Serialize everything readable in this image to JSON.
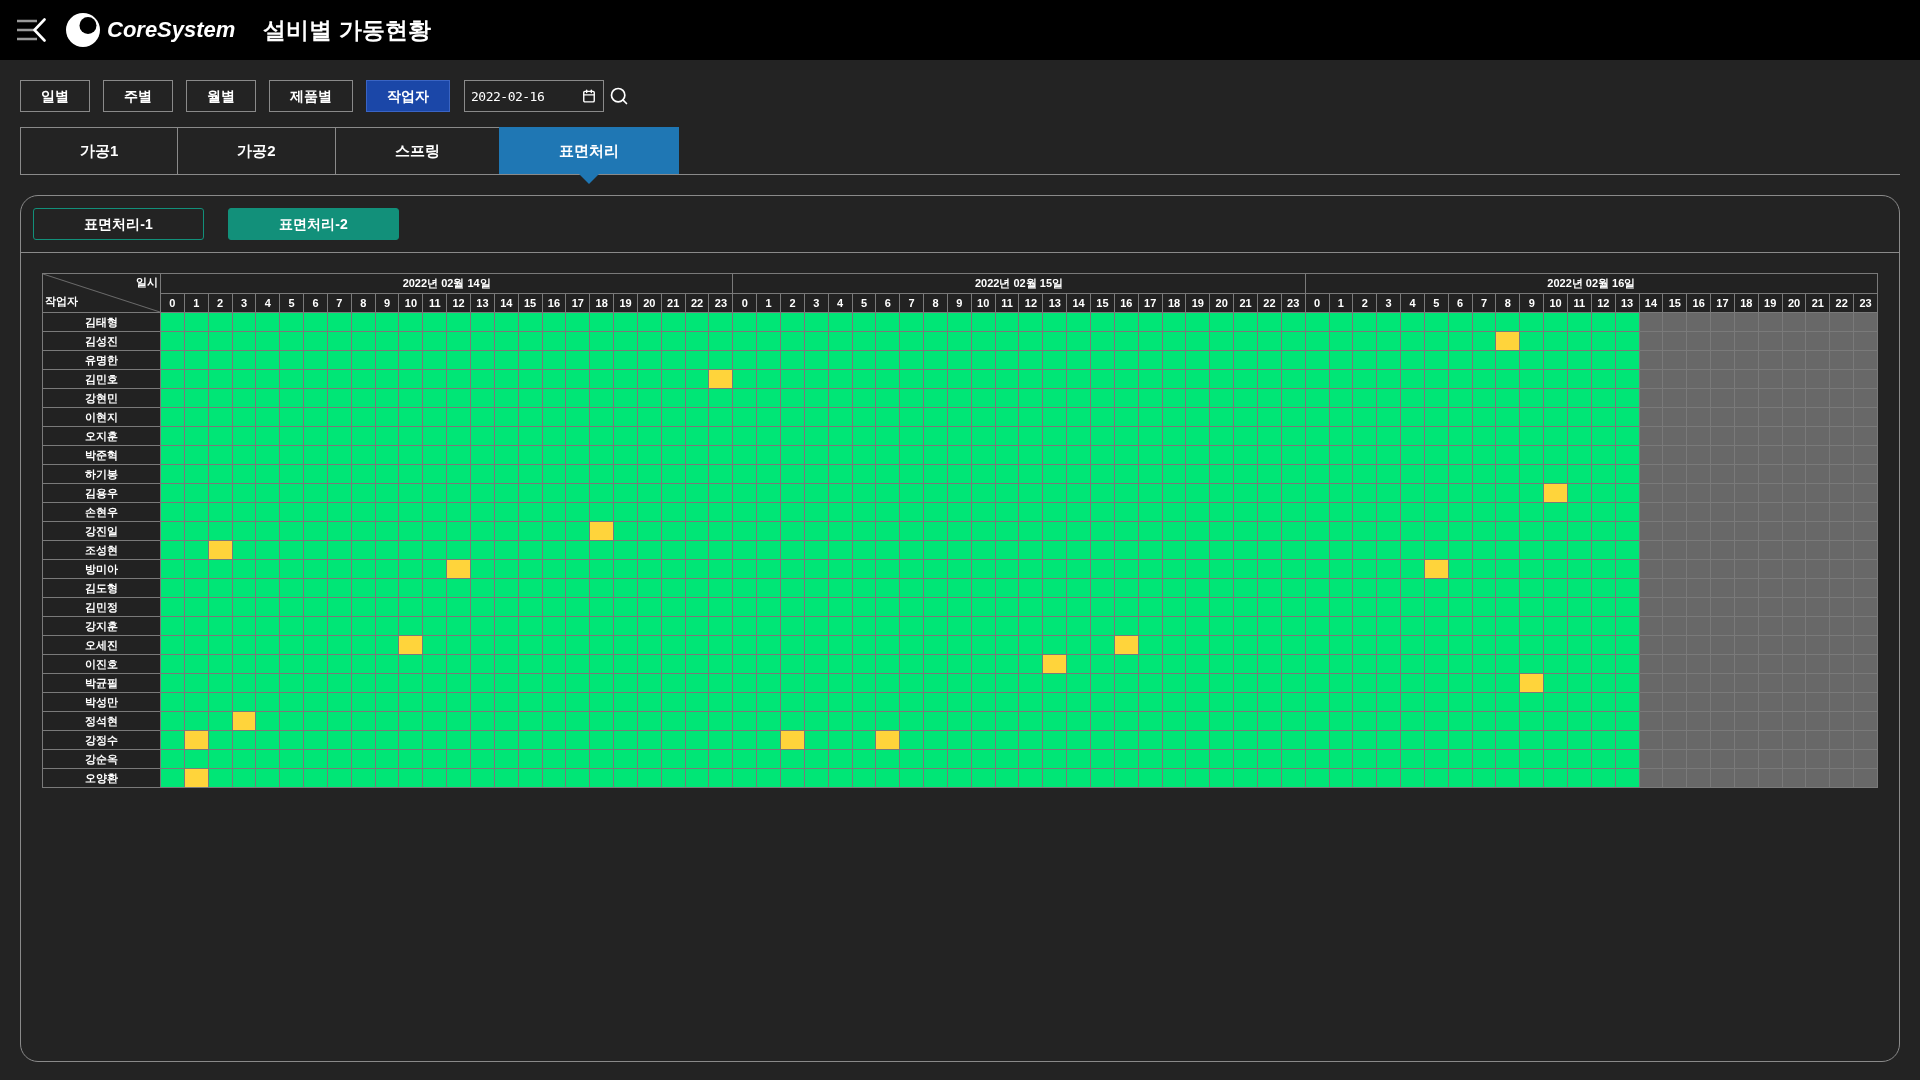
{
  "header": {
    "logo_text": "CoreSystem",
    "title": "설비별 가동현황"
  },
  "view_buttons": [
    {
      "label": "일별",
      "selected": false
    },
    {
      "label": "주별",
      "selected": false
    },
    {
      "label": "월별",
      "selected": false
    },
    {
      "label": "제품별",
      "selected": false
    },
    {
      "label": "작업자",
      "selected": true
    }
  ],
  "date_field": {
    "value": "2022-02-16"
  },
  "tabs": [
    {
      "label": "가공1",
      "selected": false
    },
    {
      "label": "가공2",
      "selected": false
    },
    {
      "label": "스프링",
      "selected": false
    },
    {
      "label": "표면처리",
      "selected": true
    }
  ],
  "sub_tabs": [
    {
      "label": "표면처리-1",
      "selected": false
    },
    {
      "label": "표면처리-2",
      "selected": true
    }
  ],
  "table": {
    "corner": {
      "column_label": "일시",
      "row_label": "작업자"
    },
    "dates": [
      {
        "label": "2022년 02월 14일",
        "hours": [
          {
            "label": "0",
            "disabled": false
          },
          {
            "label": "1",
            "disabled": false
          },
          {
            "label": "2",
            "disabled": false
          },
          {
            "label": "3",
            "disabled": false
          },
          {
            "label": "4",
            "disabled": false
          },
          {
            "label": "5",
            "disabled": false
          },
          {
            "label": "6",
            "disabled": false
          },
          {
            "label": "7",
            "disabled": false
          },
          {
            "label": "8",
            "disabled": false
          },
          {
            "label": "9",
            "disabled": false
          },
          {
            "label": "10",
            "disabled": false
          },
          {
            "label": "11",
            "disabled": false
          },
          {
            "label": "12",
            "disabled": false
          },
          {
            "label": "13",
            "disabled": false
          },
          {
            "label": "14",
            "disabled": false
          },
          {
            "label": "15",
            "disabled": false
          },
          {
            "label": "16",
            "disabled": false
          },
          {
            "label": "17",
            "disabled": false
          },
          {
            "label": "18",
            "disabled": false
          },
          {
            "label": "19",
            "disabled": false
          },
          {
            "label": "20",
            "disabled": false
          },
          {
            "label": "21",
            "disabled": false
          },
          {
            "label": "22",
            "disabled": false
          },
          {
            "label": "23",
            "disabled": false
          }
        ]
      },
      {
        "label": "2022년 02월 15일",
        "hours": [
          {
            "label": "0",
            "disabled": false
          },
          {
            "label": "1",
            "disabled": false
          },
          {
            "label": "2",
            "disabled": false
          },
          {
            "label": "3",
            "disabled": false
          },
          {
            "label": "4",
            "disabled": false
          },
          {
            "label": "5",
            "disabled": false
          },
          {
            "label": "6",
            "disabled": false
          },
          {
            "label": "7",
            "disabled": false
          },
          {
            "label": "8",
            "disabled": false
          },
          {
            "label": "9",
            "disabled": false
          },
          {
            "label": "10",
            "disabled": false
          },
          {
            "label": "11",
            "disabled": false
          },
          {
            "label": "12",
            "disabled": false
          },
          {
            "label": "13",
            "disabled": false
          },
          {
            "label": "14",
            "disabled": false
          },
          {
            "label": "15",
            "disabled": false
          },
          {
            "label": "16",
            "disabled": false
          },
          {
            "label": "17",
            "disabled": false
          },
          {
            "label": "18",
            "disabled": false
          },
          {
            "label": "19",
            "disabled": false
          },
          {
            "label": "20",
            "disabled": false
          },
          {
            "label": "21",
            "disabled": false
          },
          {
            "label": "22",
            "disabled": false
          },
          {
            "label": "23",
            "disabled": false
          }
        ]
      },
      {
        "label": "2022년 02월 16일",
        "hours": [
          {
            "label": "0",
            "disabled": false
          },
          {
            "label": "1",
            "disabled": false
          },
          {
            "label": "2",
            "disabled": false
          },
          {
            "label": "3",
            "disabled": false
          },
          {
            "label": "4",
            "disabled": false
          },
          {
            "label": "5",
            "disabled": false
          },
          {
            "label": "6",
            "disabled": false
          },
          {
            "label": "7",
            "disabled": false
          },
          {
            "label": "8",
            "disabled": false
          },
          {
            "label": "9",
            "disabled": false
          },
          {
            "label": "10",
            "disabled": false
          },
          {
            "label": "11",
            "disabled": false
          },
          {
            "label": "12",
            "disabled": false
          },
          {
            "label": "13",
            "disabled": false
          },
          {
            "label": "14",
            "disabled": true
          },
          {
            "label": "15",
            "disabled": true
          },
          {
            "label": "16",
            "disabled": true
          },
          {
            "label": "17",
            "disabled": true
          },
          {
            "label": "18",
            "disabled": true
          },
          {
            "label": "19",
            "disabled": true
          },
          {
            "label": "20",
            "disabled": true
          },
          {
            "label": "21",
            "disabled": true
          },
          {
            "label": "22",
            "disabled": true
          },
          {
            "label": "23",
            "disabled": true
          }
        ]
      }
    ],
    "rows": [
      {
        "name": "김태형",
        "highlighted": [
          false,
          false,
          false,
          false,
          false,
          false,
          false,
          false,
          false,
          false,
          false,
          false,
          false,
          false,
          false,
          false,
          false,
          false,
          false,
          false,
          false,
          false,
          false,
          false,
          false,
          false,
          false,
          false,
          false,
          false,
          false,
          false,
          false,
          false,
          false,
          false,
          false,
          false,
          false,
          false,
          false,
          false,
          false,
          false,
          false,
          false,
          false,
          false,
          false,
          false,
          false,
          false,
          false,
          false,
          false,
          false,
          false,
          false,
          false,
          false,
          false,
          false,
          false,
          false,
          false,
          false,
          false,
          false,
          false,
          false,
          false,
          false
        ]
      },
      {
        "name": "김성진",
        "highlighted": [
          false,
          false,
          false,
          false,
          false,
          false,
          false,
          false,
          false,
          false,
          false,
          false,
          false,
          false,
          false,
          false,
          false,
          false,
          false,
          false,
          false,
          false,
          false,
          false,
          false,
          false,
          false,
          false,
          false,
          false,
          false,
          false,
          false,
          false,
          false,
          false,
          false,
          false,
          false,
          false,
          false,
          false,
          false,
          false,
          false,
          false,
          false,
          false,
          false,
          false,
          false,
          false,
          false,
          false,
          false,
          false,
          true,
          false,
          false,
          false,
          false,
          false,
          false,
          false,
          false,
          false,
          false,
          false,
          false,
          false,
          false,
          false
        ]
      },
      {
        "name": "유명한",
        "highlighted": [
          false,
          false,
          false,
          false,
          false,
          false,
          false,
          false,
          false,
          false,
          false,
          false,
          false,
          false,
          false,
          false,
          false,
          false,
          false,
          false,
          false,
          false,
          false,
          false,
          false,
          false,
          false,
          false,
          false,
          false,
          false,
          false,
          false,
          false,
          false,
          false,
          false,
          false,
          false,
          false,
          false,
          false,
          false,
          false,
          false,
          false,
          false,
          false,
          false,
          false,
          false,
          false,
          false,
          false,
          false,
          false,
          false,
          false,
          false,
          false,
          false,
          false,
          false,
          false,
          false,
          false,
          false,
          false,
          false,
          false,
          false,
          false
        ]
      },
      {
        "name": "김민호",
        "highlighted": [
          false,
          false,
          false,
          false,
          false,
          false,
          false,
          false,
          false,
          false,
          false,
          false,
          false,
          false,
          false,
          false,
          false,
          false,
          false,
          false,
          false,
          false,
          false,
          true,
          false,
          false,
          false,
          false,
          false,
          false,
          false,
          false,
          false,
          false,
          false,
          false,
          false,
          false,
          false,
          false,
          false,
          false,
          false,
          false,
          false,
          false,
          false,
          false,
          false,
          false,
          false,
          false,
          false,
          false,
          false,
          false,
          false,
          false,
          false,
          false,
          false,
          false,
          false,
          false,
          false,
          false,
          false,
          false,
          false,
          false,
          false,
          false
        ]
      },
      {
        "name": "강현민",
        "highlighted": [
          false,
          false,
          false,
          false,
          false,
          false,
          false,
          false,
          false,
          false,
          false,
          false,
          false,
          false,
          false,
          false,
          false,
          false,
          false,
          false,
          false,
          false,
          false,
          false,
          false,
          false,
          false,
          false,
          false,
          false,
          false,
          false,
          false,
          false,
          false,
          false,
          false,
          false,
          false,
          false,
          false,
          false,
          false,
          false,
          false,
          false,
          false,
          false,
          false,
          false,
          false,
          false,
          false,
          false,
          false,
          false,
          false,
          false,
          false,
          false,
          false,
          false,
          false,
          false,
          false,
          false,
          false,
          false,
          false,
          false,
          false,
          false
        ]
      },
      {
        "name": "이현지",
        "highlighted": [
          false,
          false,
          false,
          false,
          false,
          false,
          false,
          false,
          false,
          false,
          false,
          false,
          false,
          false,
          false,
          false,
          false,
          false,
          false,
          false,
          false,
          false,
          false,
          false,
          false,
          false,
          false,
          false,
          false,
          false,
          false,
          false,
          false,
          false,
          false,
          false,
          false,
          false,
          false,
          false,
          false,
          false,
          false,
          false,
          false,
          false,
          false,
          false,
          false,
          false,
          false,
          false,
          false,
          false,
          false,
          false,
          false,
          false,
          false,
          false,
          false,
          false,
          false,
          false,
          false,
          false,
          false,
          false,
          false,
          false,
          false,
          false
        ]
      },
      {
        "name": "오지훈",
        "highlighted": [
          false,
          false,
          false,
          false,
          false,
          false,
          false,
          false,
          false,
          false,
          false,
          false,
          false,
          false,
          false,
          false,
          false,
          false,
          false,
          false,
          false,
          false,
          false,
          false,
          false,
          false,
          false,
          false,
          false,
          false,
          false,
          false,
          false,
          false,
          false,
          false,
          false,
          false,
          false,
          false,
          false,
          false,
          false,
          false,
          false,
          false,
          false,
          false,
          false,
          false,
          false,
          false,
          false,
          false,
          false,
          false,
          false,
          false,
          false,
          false,
          false,
          false,
          false,
          false,
          false,
          false,
          false,
          false,
          false,
          false,
          false,
          false
        ]
      },
      {
        "name": "박준혁",
        "highlighted": [
          false,
          false,
          false,
          false,
          false,
          false,
          false,
          false,
          false,
          false,
          false,
          false,
          false,
          false,
          false,
          false,
          false,
          false,
          false,
          false,
          false,
          false,
          false,
          false,
          false,
          false,
          false,
          false,
          false,
          false,
          false,
          false,
          false,
          false,
          false,
          false,
          false,
          false,
          false,
          false,
          false,
          false,
          false,
          false,
          false,
          false,
          false,
          false,
          false,
          false,
          false,
          false,
          false,
          false,
          false,
          false,
          false,
          false,
          false,
          false,
          false,
          false,
          false,
          false,
          false,
          false,
          false,
          false,
          false,
          false,
          false,
          false
        ]
      },
      {
        "name": "하기봉",
        "highlighted": [
          false,
          false,
          false,
          false,
          false,
          false,
          false,
          false,
          false,
          false,
          false,
          false,
          false,
          false,
          false,
          false,
          false,
          false,
          false,
          false,
          false,
          false,
          false,
          false,
          false,
          false,
          false,
          false,
          false,
          false,
          false,
          false,
          false,
          false,
          false,
          false,
          false,
          false,
          false,
          false,
          false,
          false,
          false,
          false,
          false,
          false,
          false,
          false,
          false,
          false,
          false,
          false,
          false,
          false,
          false,
          false,
          false,
          false,
          false,
          false,
          false,
          false,
          false,
          false,
          false,
          false,
          false,
          false,
          false,
          false,
          false,
          false
        ]
      },
      {
        "name": "김용우",
        "highlighted": [
          false,
          false,
          false,
          false,
          false,
          false,
          false,
          false,
          false,
          false,
          false,
          false,
          false,
          false,
          false,
          false,
          false,
          false,
          false,
          false,
          false,
          false,
          false,
          false,
          false,
          false,
          false,
          false,
          false,
          false,
          false,
          false,
          false,
          false,
          false,
          false,
          false,
          false,
          false,
          false,
          false,
          false,
          false,
          false,
          false,
          false,
          false,
          false,
          false,
          false,
          false,
          false,
          false,
          false,
          false,
          false,
          false,
          false,
          true,
          false,
          false,
          false,
          false,
          false,
          false,
          false,
          false,
          false,
          false,
          false,
          false,
          false
        ]
      },
      {
        "name": "손현우",
        "highlighted": [
          false,
          false,
          false,
          false,
          false,
          false,
          false,
          false,
          false,
          false,
          false,
          false,
          false,
          false,
          false,
          false,
          false,
          false,
          false,
          false,
          false,
          false,
          false,
          false,
          false,
          false,
          false,
          false,
          false,
          false,
          false,
          false,
          false,
          false,
          false,
          false,
          false,
          false,
          false,
          false,
          false,
          false,
          false,
          false,
          false,
          false,
          false,
          false,
          false,
          false,
          false,
          false,
          false,
          false,
          false,
          false,
          false,
          false,
          false,
          false,
          false,
          false,
          false,
          false,
          false,
          false,
          false,
          false,
          false,
          false,
          false,
          false
        ]
      },
      {
        "name": "강진일",
        "highlighted": [
          false,
          false,
          false,
          false,
          false,
          false,
          false,
          false,
          false,
          false,
          false,
          false,
          false,
          false,
          false,
          false,
          false,
          false,
          true,
          false,
          false,
          false,
          false,
          false,
          false,
          false,
          false,
          false,
          false,
          false,
          false,
          false,
          false,
          false,
          false,
          false,
          false,
          false,
          false,
          false,
          false,
          false,
          false,
          false,
          false,
          false,
          false,
          false,
          false,
          false,
          false,
          false,
          false,
          false,
          false,
          false,
          false,
          false,
          false,
          false,
          false,
          false,
          false,
          false,
          false,
          false,
          false,
          false,
          false,
          false,
          false,
          false
        ]
      },
      {
        "name": "조성현",
        "highlighted": [
          false,
          false,
          true,
          false,
          false,
          false,
          false,
          false,
          false,
          false,
          false,
          false,
          false,
          false,
          false,
          false,
          false,
          false,
          false,
          false,
          false,
          false,
          false,
          false,
          false,
          false,
          false,
          false,
          false,
          false,
          false,
          false,
          false,
          false,
          false,
          false,
          false,
          false,
          false,
          false,
          false,
          false,
          false,
          false,
          false,
          false,
          false,
          false,
          false,
          false,
          false,
          false,
          false,
          false,
          false,
          false,
          false,
          false,
          false,
          false,
          false,
          false,
          false,
          false,
          false,
          false,
          false,
          false,
          false,
          false,
          false,
          false
        ]
      },
      {
        "name": "방미아",
        "highlighted": [
          false,
          false,
          false,
          false,
          false,
          false,
          false,
          false,
          false,
          false,
          false,
          false,
          true,
          false,
          false,
          false,
          false,
          false,
          false,
          false,
          false,
          false,
          false,
          false,
          false,
          false,
          false,
          false,
          false,
          false,
          false,
          false,
          false,
          false,
          false,
          false,
          false,
          false,
          false,
          false,
          false,
          false,
          false,
          false,
          false,
          false,
          false,
          false,
          false,
          false,
          false,
          false,
          false,
          true,
          false,
          false,
          false,
          false,
          false,
          false,
          false,
          false,
          false,
          false,
          false,
          false,
          false,
          false,
          false,
          false,
          false,
          false
        ]
      },
      {
        "name": "김도형",
        "highlighted": [
          false,
          false,
          false,
          false,
          false,
          false,
          false,
          false,
          false,
          false,
          false,
          false,
          false,
          false,
          false,
          false,
          false,
          false,
          false,
          false,
          false,
          false,
          false,
          false,
          false,
          false,
          false,
          false,
          false,
          false,
          false,
          false,
          false,
          false,
          false,
          false,
          false,
          false,
          false,
          false,
          false,
          false,
          false,
          false,
          false,
          false,
          false,
          false,
          false,
          false,
          false,
          false,
          false,
          false,
          false,
          false,
          false,
          false,
          false,
          false,
          false,
          false,
          false,
          false,
          false,
          false,
          false,
          false,
          false,
          false,
          false,
          false
        ]
      },
      {
        "name": "김민정",
        "highlighted": [
          false,
          false,
          false,
          false,
          false,
          false,
          false,
          false,
          false,
          false,
          false,
          false,
          false,
          false,
          false,
          false,
          false,
          false,
          false,
          false,
          false,
          false,
          false,
          false,
          false,
          false,
          false,
          false,
          false,
          false,
          false,
          false,
          false,
          false,
          false,
          false,
          false,
          false,
          false,
          false,
          false,
          false,
          false,
          false,
          false,
          false,
          false,
          false,
          false,
          false,
          false,
          false,
          false,
          false,
          false,
          false,
          false,
          false,
          false,
          false,
          false,
          false,
          false,
          false,
          false,
          false,
          false,
          false,
          false,
          false,
          false,
          false
        ]
      },
      {
        "name": "강지훈",
        "highlighted": [
          false,
          false,
          false,
          false,
          false,
          false,
          false,
          false,
          false,
          false,
          false,
          false,
          false,
          false,
          false,
          false,
          false,
          false,
          false,
          false,
          false,
          false,
          false,
          false,
          false,
          false,
          false,
          false,
          false,
          false,
          false,
          false,
          false,
          false,
          false,
          false,
          false,
          false,
          false,
          false,
          false,
          false,
          false,
          false,
          false,
          false,
          false,
          false,
          false,
          false,
          false,
          false,
          false,
          false,
          false,
          false,
          false,
          false,
          false,
          false,
          false,
          false,
          false,
          false,
          false,
          false,
          false,
          false,
          false,
          false,
          false,
          false
        ]
      },
      {
        "name": "오세진",
        "highlighted": [
          false,
          false,
          false,
          false,
          false,
          false,
          false,
          false,
          false,
          false,
          true,
          false,
          false,
          false,
          false,
          false,
          false,
          false,
          false,
          false,
          false,
          false,
          false,
          false,
          false,
          false,
          false,
          false,
          false,
          false,
          false,
          false,
          false,
          false,
          false,
          false,
          false,
          false,
          false,
          false,
          true,
          false,
          false,
          false,
          false,
          false,
          false,
          false,
          false,
          false,
          false,
          false,
          false,
          false,
          false,
          false,
          false,
          false,
          false,
          false,
          false,
          false,
          false,
          false,
          false,
          false,
          false,
          false,
          false,
          false,
          false,
          false
        ]
      },
      {
        "name": "이진호",
        "highlighted": [
          false,
          false,
          false,
          false,
          false,
          false,
          false,
          false,
          false,
          false,
          false,
          false,
          false,
          false,
          false,
          false,
          false,
          false,
          false,
          false,
          false,
          false,
          false,
          false,
          false,
          false,
          false,
          false,
          false,
          false,
          false,
          false,
          false,
          false,
          false,
          false,
          false,
          true,
          false,
          false,
          false,
          false,
          false,
          false,
          false,
          false,
          false,
          false,
          false,
          false,
          false,
          false,
          false,
          false,
          false,
          false,
          false,
          false,
          false,
          false,
          false,
          false,
          false,
          false,
          false,
          false,
          false,
          false,
          false,
          false,
          false,
          false
        ]
      },
      {
        "name": "박균필",
        "highlighted": [
          false,
          false,
          false,
          false,
          false,
          false,
          false,
          false,
          false,
          false,
          false,
          false,
          false,
          false,
          false,
          false,
          false,
          false,
          false,
          false,
          false,
          false,
          false,
          false,
          false,
          false,
          false,
          false,
          false,
          false,
          false,
          false,
          false,
          false,
          false,
          false,
          false,
          false,
          false,
          false,
          false,
          false,
          false,
          false,
          false,
          false,
          false,
          false,
          false,
          false,
          false,
          false,
          false,
          false,
          false,
          false,
          false,
          true,
          false,
          false,
          false,
          false,
          false,
          false,
          false,
          false,
          false,
          false,
          false,
          false,
          false,
          false
        ]
      },
      {
        "name": "박성만",
        "highlighted": [
          false,
          false,
          false,
          false,
          false,
          false,
          false,
          false,
          false,
          false,
          false,
          false,
          false,
          false,
          false,
          false,
          false,
          false,
          false,
          false,
          false,
          false,
          false,
          false,
          false,
          false,
          false,
          false,
          false,
          false,
          false,
          false,
          false,
          false,
          false,
          false,
          false,
          false,
          false,
          false,
          false,
          false,
          false,
          false,
          false,
          false,
          false,
          false,
          false,
          false,
          false,
          false,
          false,
          false,
          false,
          false,
          false,
          false,
          false,
          false,
          false,
          false,
          false,
          false,
          false,
          false,
          false,
          false,
          false,
          false,
          false,
          false
        ]
      },
      {
        "name": "정석현",
        "highlighted": [
          false,
          false,
          false,
          true,
          false,
          false,
          false,
          false,
          false,
          false,
          false,
          false,
          false,
          false,
          false,
          false,
          false,
          false,
          false,
          false,
          false,
          false,
          false,
          false,
          false,
          false,
          false,
          false,
          false,
          false,
          false,
          false,
          false,
          false,
          false,
          false,
          false,
          false,
          false,
          false,
          false,
          false,
          false,
          false,
          false,
          false,
          false,
          false,
          false,
          false,
          false,
          false,
          false,
          false,
          false,
          false,
          false,
          false,
          false,
          false,
          false,
          false,
          false,
          false,
          false,
          false,
          false,
          false,
          false,
          false,
          false,
          false
        ]
      },
      {
        "name": "강정수",
        "highlighted": [
          false,
          true,
          false,
          false,
          false,
          false,
          false,
          false,
          false,
          false,
          false,
          false,
          false,
          false,
          false,
          false,
          false,
          false,
          false,
          false,
          false,
          false,
          false,
          false,
          false,
          false,
          true,
          false,
          false,
          false,
          true,
          false,
          false,
          false,
          false,
          false,
          false,
          false,
          false,
          false,
          false,
          false,
          false,
          false,
          false,
          false,
          false,
          false,
          false,
          false,
          false,
          false,
          false,
          false,
          false,
          false,
          false,
          false,
          false,
          false,
          false,
          false,
          false,
          false,
          false,
          false,
          false,
          false,
          false,
          false,
          false,
          false
        ]
      },
      {
        "name": "강순옥",
        "highlighted": [
          false,
          false,
          false,
          false,
          false,
          false,
          false,
          false,
          false,
          false,
          false,
          false,
          false,
          false,
          false,
          false,
          false,
          false,
          false,
          false,
          false,
          false,
          false,
          false,
          false,
          false,
          false,
          false,
          false,
          false,
          false,
          false,
          false,
          false,
          false,
          false,
          false,
          false,
          false,
          false,
          false,
          false,
          false,
          false,
          false,
          false,
          false,
          false,
          false,
          false,
          false,
          false,
          false,
          false,
          false,
          false,
          false,
          false,
          false,
          false,
          false,
          false,
          false,
          false,
          false,
          false,
          false,
          false,
          false,
          false,
          false,
          false
        ]
      },
      {
        "name": "오양환",
        "highlighted": [
          false,
          true,
          false,
          false,
          false,
          false,
          false,
          false,
          false,
          false,
          false,
          false,
          false,
          false,
          false,
          false,
          false,
          false,
          false,
          false,
          false,
          false,
          false,
          false,
          false,
          false,
          false,
          false,
          false,
          false,
          false,
          false,
          false,
          false,
          false,
          false,
          false,
          false,
          false,
          false,
          false,
          false,
          false,
          false,
          false,
          false,
          false,
          false,
          false,
          false,
          false,
          false,
          false,
          false,
          false,
          false,
          false,
          false,
          false,
          false,
          false,
          false,
          false,
          false,
          false,
          false,
          false,
          false,
          false,
          false,
          false,
          false
        ]
      }
    ]
  }
}
